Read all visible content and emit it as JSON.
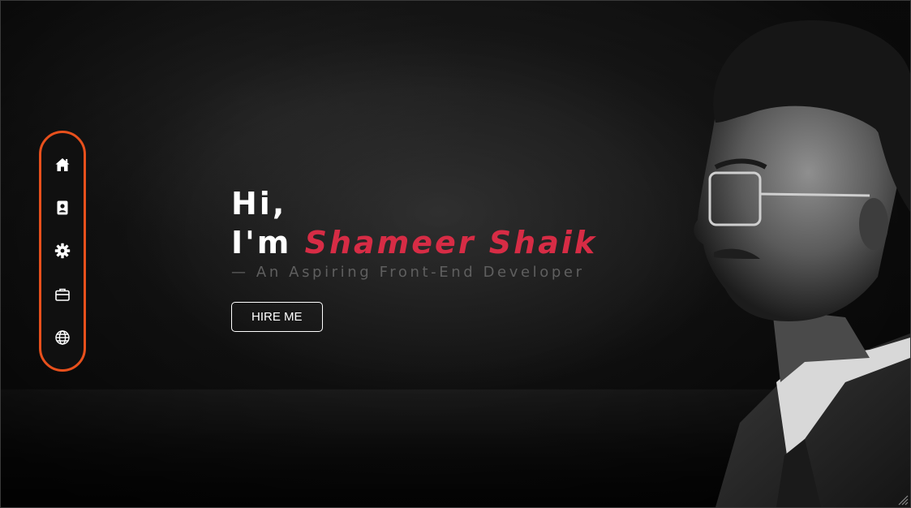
{
  "sidebar": {
    "border_color": "#e8501c",
    "items": [
      {
        "icon": "home-icon"
      },
      {
        "icon": "contact-card-icon"
      },
      {
        "icon": "gear-icon"
      },
      {
        "icon": "briefcase-icon"
      },
      {
        "icon": "globe-icon"
      }
    ]
  },
  "hero": {
    "greeting": "Hi,",
    "intro": "I'm ",
    "name": "Shameer Shaik",
    "subtitle": "— An Aspiring Front-End Developer",
    "button_label": "HIRE ME",
    "accent_color": "#d72c45"
  }
}
